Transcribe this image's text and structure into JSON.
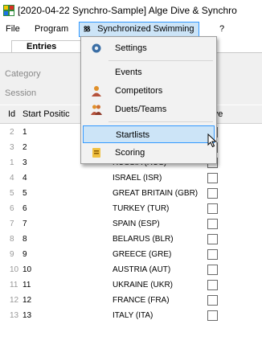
{
  "window": {
    "title": "[2020-04-22 Synchro-Sample] Alge Dive & Synchro"
  },
  "menubar": {
    "file": "File",
    "program": "Program",
    "synchro_icon_text": "ꝸꝸ",
    "synchro": "Synchronized Swimming",
    "help": "?"
  },
  "tabs": {
    "entries": "Entries"
  },
  "panel": {
    "category_label": "Category",
    "session_label": "Session"
  },
  "grid": {
    "headers": {
      "id": "Id",
      "start_position": "Start Positic",
      "reserve": "erve"
    },
    "rows": [
      {
        "id": "2",
        "start": "1",
        "name": ""
      },
      {
        "id": "3",
        "start": "2",
        "name": ""
      },
      {
        "id": "1",
        "start": "3",
        "name": "RUSSIA (RUS)"
      },
      {
        "id": "4",
        "start": "4",
        "name": "ISRAEL (ISR)"
      },
      {
        "id": "5",
        "start": "5",
        "name": "GREAT BRITAIN (GBR)"
      },
      {
        "id": "6",
        "start": "6",
        "name": "TURKEY (TUR)"
      },
      {
        "id": "7",
        "start": "7",
        "name": "SPAIN (ESP)"
      },
      {
        "id": "8",
        "start": "8",
        "name": "BELARUS (BLR)"
      },
      {
        "id": "9",
        "start": "9",
        "name": "GREECE (GRE)"
      },
      {
        "id": "10",
        "start": "10",
        "name": "AUSTRIA (AUT)"
      },
      {
        "id": "11",
        "start": "11",
        "name": "UKRAINE (UKR)"
      },
      {
        "id": "12",
        "start": "12",
        "name": "FRANCE (FRA)"
      },
      {
        "id": "13",
        "start": "13",
        "name": "ITALY (ITA)"
      }
    ]
  },
  "dropdown": {
    "settings": "Settings",
    "events": "Events",
    "competitors": "Competitors",
    "duets_teams": "Duets/Teams",
    "startlists": "Startlists",
    "scoring": "Scoring"
  },
  "colors": {
    "highlight_bg": "#cce4f7",
    "highlight_border": "#3399ff"
  }
}
